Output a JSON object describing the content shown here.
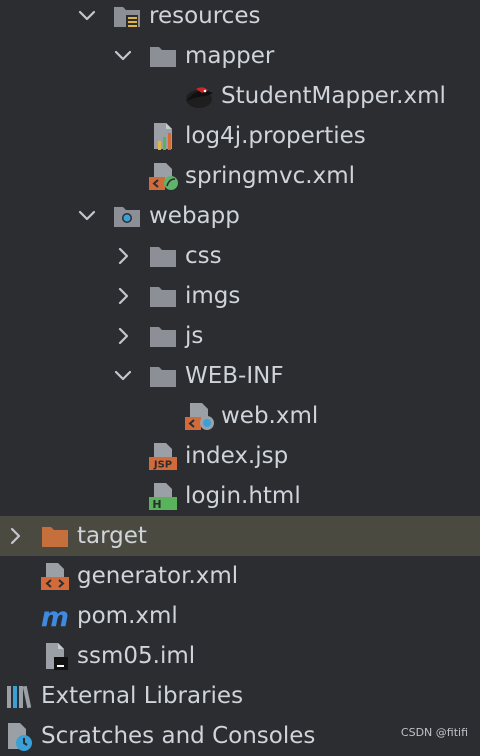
{
  "tree": {
    "resources": "resources",
    "mapper": "mapper",
    "student_mapper": "StudentMapper.xml",
    "log4j": "log4j.properties",
    "springmvc": "springmvc.xml",
    "webapp": "webapp",
    "css": "css",
    "imgs": "imgs",
    "js": "js",
    "web_inf": "WEB-INF",
    "web_xml": "web.xml",
    "index_jsp": "index.jsp",
    "login_html": "login.html",
    "target": "target",
    "generator": "generator.xml",
    "pom": "pom.xml",
    "iml": "ssm05.iml",
    "external_libraries": "External Libraries",
    "scratches": "Scratches and Consoles"
  },
  "icons": {
    "jsp_badge": "JSP",
    "html_badge": "H",
    "maven_letter": "m"
  },
  "watermark": "CSDN @fitifi",
  "colors": {
    "background": "#2b2d30",
    "selection": "#4b4a41",
    "folder": "#8c9096",
    "target_folder": "#c56f3c",
    "xml_badge": "#d36a3a",
    "maven": "#3d8ae0"
  }
}
